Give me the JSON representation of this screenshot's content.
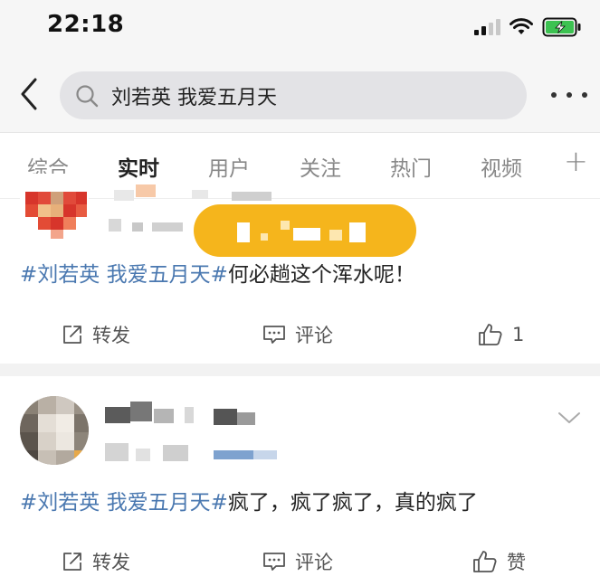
{
  "status_bar": {
    "time": "22:18"
  },
  "search": {
    "query": "刘若英 我爱五月天"
  },
  "tabs": [
    {
      "label": "综合",
      "active": false
    },
    {
      "label": "实时",
      "active": true
    },
    {
      "label": "用户",
      "active": false
    },
    {
      "label": "关注",
      "active": false
    },
    {
      "label": "热门",
      "active": false
    },
    {
      "label": "视频",
      "active": false
    }
  ],
  "tabs_more": "+",
  "posts": [
    {
      "topic": "#刘若英 我爱五月天#",
      "text": "何必趟这个浑水呢！",
      "repost_label": "转发",
      "comment_label": "评论",
      "like_label": "1"
    },
    {
      "topic": "#刘若英 我爱五月天#",
      "text": "疯了，疯了疯了，真的疯了",
      "repost_label": "转发",
      "comment_label": "评论",
      "like_label": "赞"
    }
  ],
  "colors": {
    "topic": "#4a78b0",
    "badge": "#f5b51c",
    "battery": "#3cc251"
  }
}
